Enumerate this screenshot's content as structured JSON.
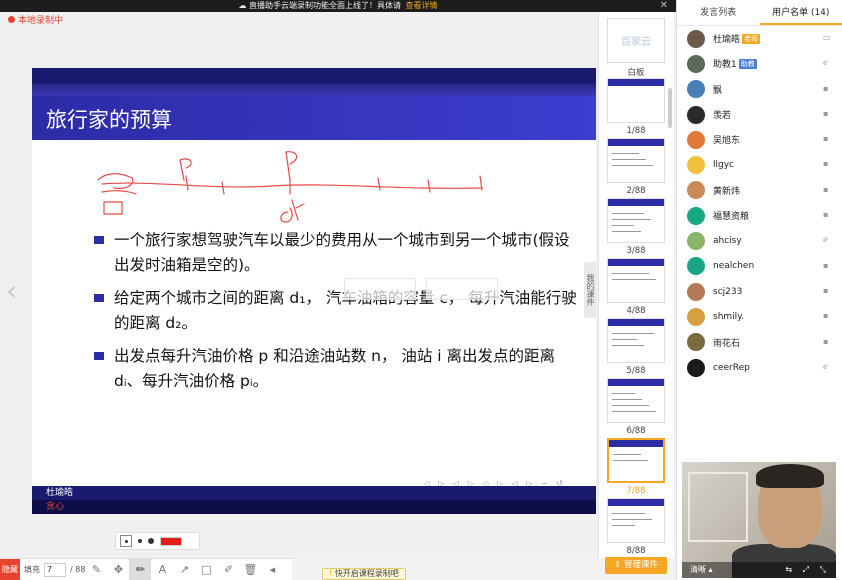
{
  "notice": {
    "text": "直播助手云端录制功能全面上线了！具体请",
    "link": "查看详情",
    "close": "✕"
  },
  "recording": {
    "label": "本地录制中"
  },
  "slide": {
    "title": "旅行家的预算",
    "bullets": [
      "一个旅行家想驾驶汽车以最少的费用从一个城市到另一个城市(假设出发时油箱是空的)。",
      "给定两个城市之间的距离 d₁， 汽车油箱的容量 c， 每升汽油能行驶的距离 d₂。",
      "出发点每升汽油价格 p 和沿途油站数 n， 油站 i 离出发点的距离 dᵢ、每升汽油价格 pᵢ。"
    ],
    "footer_author": "杜瑜皓",
    "footer_org": "贪心",
    "nav_symbols": "◁ ▷ ◁ ▷ ◁ ▷ ◁ ▷ ∽ ↺"
  },
  "toolbar": {
    "hide_label": "隐藏",
    "fill_label": "填充",
    "page_current": "7",
    "page_total": "/ 88",
    "tools": [
      "✎",
      "✥",
      "✏",
      "A",
      "↗",
      "□",
      "✐",
      "🗑",
      "◂"
    ]
  },
  "toast": {
    "icon": "!",
    "text": "快开启课程录制吧"
  },
  "thumbnails": {
    "whiteboard_label": "白板",
    "whiteboard_logo": "百家云",
    "pages": [
      "1/88",
      "2/88",
      "3/88",
      "4/88",
      "5/88",
      "6/88",
      "7/88",
      "8/88"
    ],
    "active_index": 6,
    "my_courseware": "我的课件",
    "manage_button": "管理课件"
  },
  "right_panel": {
    "tabs": [
      "发言列表",
      "用户名单 (14)"
    ],
    "active_tab": 1,
    "users": [
      {
        "name": "杜瑜皓",
        "badge": "老师",
        "badge_type": "teacher",
        "color": "#6b5a4a",
        "device": "pc"
      },
      {
        "name": "助教1",
        "badge": "助教",
        "badge_type": "ta",
        "color": "#5a6a5a",
        "device": "web"
      },
      {
        "name": "飘",
        "badge": "",
        "color": "#4a7fb5",
        "device": "win"
      },
      {
        "name": "羡若",
        "badge": "",
        "color": "#2a2a2a",
        "device": "win"
      },
      {
        "name": "吴旭东",
        "badge": "",
        "color": "#e07a3a",
        "device": "win"
      },
      {
        "name": "llgyc",
        "badge": "",
        "color": "#f0c040",
        "device": "win"
      },
      {
        "name": "黄新炜",
        "badge": "",
        "color": "#c98a5a",
        "device": "win"
      },
      {
        "name": "福慧资粮",
        "badge": "",
        "color": "#1aa585",
        "device": "win"
      },
      {
        "name": "ahcisy",
        "badge": "",
        "color": "#8ab56a",
        "device": "web"
      },
      {
        "name": "nealchen",
        "badge": "",
        "color": "#1aa585",
        "device": "win"
      },
      {
        "name": "scj233",
        "badge": "",
        "color": "#b57a5a",
        "device": "win"
      },
      {
        "name": "shmily.",
        "badge": "",
        "color": "#d6a040",
        "device": "win"
      },
      {
        "name": "雨花石",
        "badge": "",
        "color": "#7a6a40",
        "device": "win"
      },
      {
        "name": "ceerRep",
        "badge": "",
        "color": "#1a1a1a",
        "device": "web"
      }
    ]
  },
  "video": {
    "quality": "清晰 ▴",
    "icons": "⇆ ⤢ ⤡"
  },
  "colors": {
    "accent": "#f5a623",
    "slide_blue": "#2c2ca6",
    "record_red": "#e8432e"
  }
}
